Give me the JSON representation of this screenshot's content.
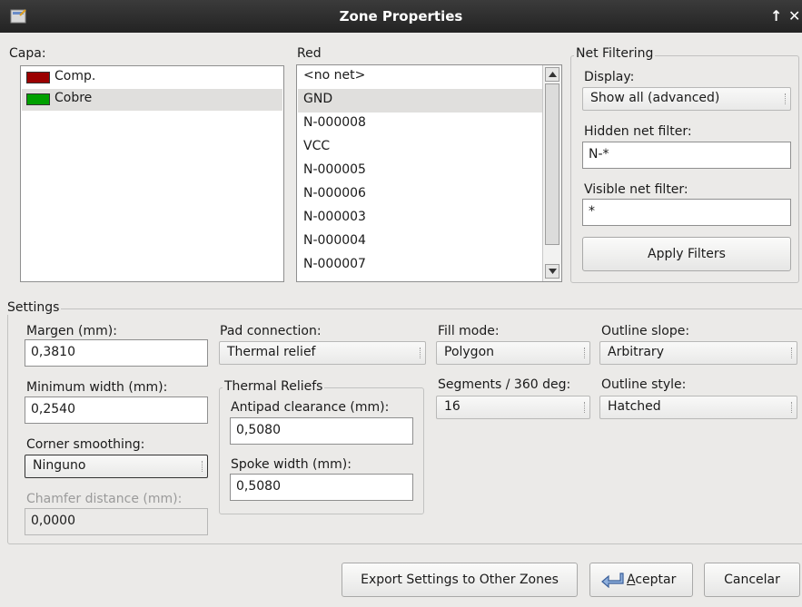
{
  "window": {
    "title": "Zone Properties",
    "minimize_glyph": "↑",
    "close_glyph": "✕"
  },
  "layers": {
    "label": "Capa:",
    "items": [
      {
        "name": "Comp.",
        "color": "#9b0000",
        "selected": false
      },
      {
        "name": "Cobre",
        "color": "#00a000",
        "selected": true
      }
    ]
  },
  "nets": {
    "label": "Red",
    "items": [
      "<no net>",
      "GND",
      "N-000008",
      "VCC",
      "N-000005",
      "N-000006",
      "N-000003",
      "N-000004",
      "N-000007"
    ],
    "selected": "GND"
  },
  "net_filtering": {
    "title": "Net Filtering",
    "display_label": "Display:",
    "display_value": "Show all (advanced)",
    "hidden_label": "Hidden net filter:",
    "hidden_value": "N-*",
    "visible_label": "Visible net filter:",
    "visible_value": "*",
    "apply_label": "Apply Filters"
  },
  "settings": {
    "title": "Settings",
    "margin_label": "Margen (mm):",
    "margin_value": "0,3810",
    "min_width_label": "Minimum width (mm):",
    "min_width_value": "0,2540",
    "corner_label": "Corner smoothing:",
    "corner_value": "Ninguno",
    "chamfer_label": "Chamfer distance (mm):",
    "chamfer_value": "0,0000",
    "pad_conn_label": "Pad connection:",
    "pad_conn_value": "Thermal relief",
    "thermal_title": "Thermal Reliefs",
    "antipad_label": "Antipad clearance (mm):",
    "antipad_value": "0,5080",
    "spoke_label": "Spoke width (mm):",
    "spoke_value": "0,5080",
    "fill_mode_label": "Fill mode:",
    "fill_mode_value": "Polygon",
    "segments_label": "Segments / 360 deg:",
    "segments_value": "16",
    "outline_slope_label": "Outline slope:",
    "outline_slope_value": "Arbitrary",
    "outline_style_label": "Outline style:",
    "outline_style_value": "Hatched"
  },
  "buttons": {
    "export_label": "Export Settings to Other Zones",
    "ok_accel": "A",
    "ok_rest": "ceptar",
    "cancel_label": "Cancelar"
  }
}
